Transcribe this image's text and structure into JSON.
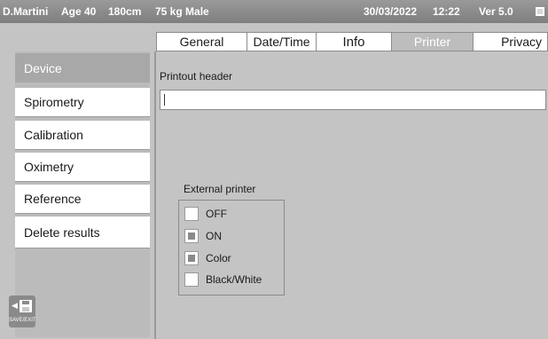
{
  "status": {
    "patient": "D.Martini",
    "age": "Age 40",
    "height": "180cm",
    "weight_sex": "75 kg Male",
    "date": "30/03/2022",
    "time": "12:22",
    "version": "Ver 5.0"
  },
  "tabs": [
    {
      "label": "General"
    },
    {
      "label": "Date/Time"
    },
    {
      "label": "Info"
    },
    {
      "label": "Printer"
    },
    {
      "label": "Privacy"
    }
  ],
  "active_tab": "Printer",
  "sidebar": {
    "items": [
      {
        "label": "Device"
      },
      {
        "label": "Spirometry"
      },
      {
        "label": "Calibration"
      },
      {
        "label": "Oximetry"
      },
      {
        "label": "Reference"
      },
      {
        "label": "Delete  results"
      }
    ],
    "active": "Device"
  },
  "printer": {
    "header_label": "Printout header",
    "header_value": "",
    "external_label": "External printer",
    "options": [
      {
        "label": "OFF",
        "checked": false
      },
      {
        "label": "ON",
        "checked": true
      },
      {
        "label": "Color",
        "checked": true
      },
      {
        "label": "Black/White",
        "checked": false
      }
    ]
  },
  "save_exit": {
    "label": "SAVE/EXIT",
    "icon": "save-exit-icon"
  },
  "colors": {
    "background": "#c4c4c4",
    "statusbar": "#8a8a8a",
    "active_item": "#a8a8a8",
    "checkbox_fill": "#8a8a8a"
  }
}
